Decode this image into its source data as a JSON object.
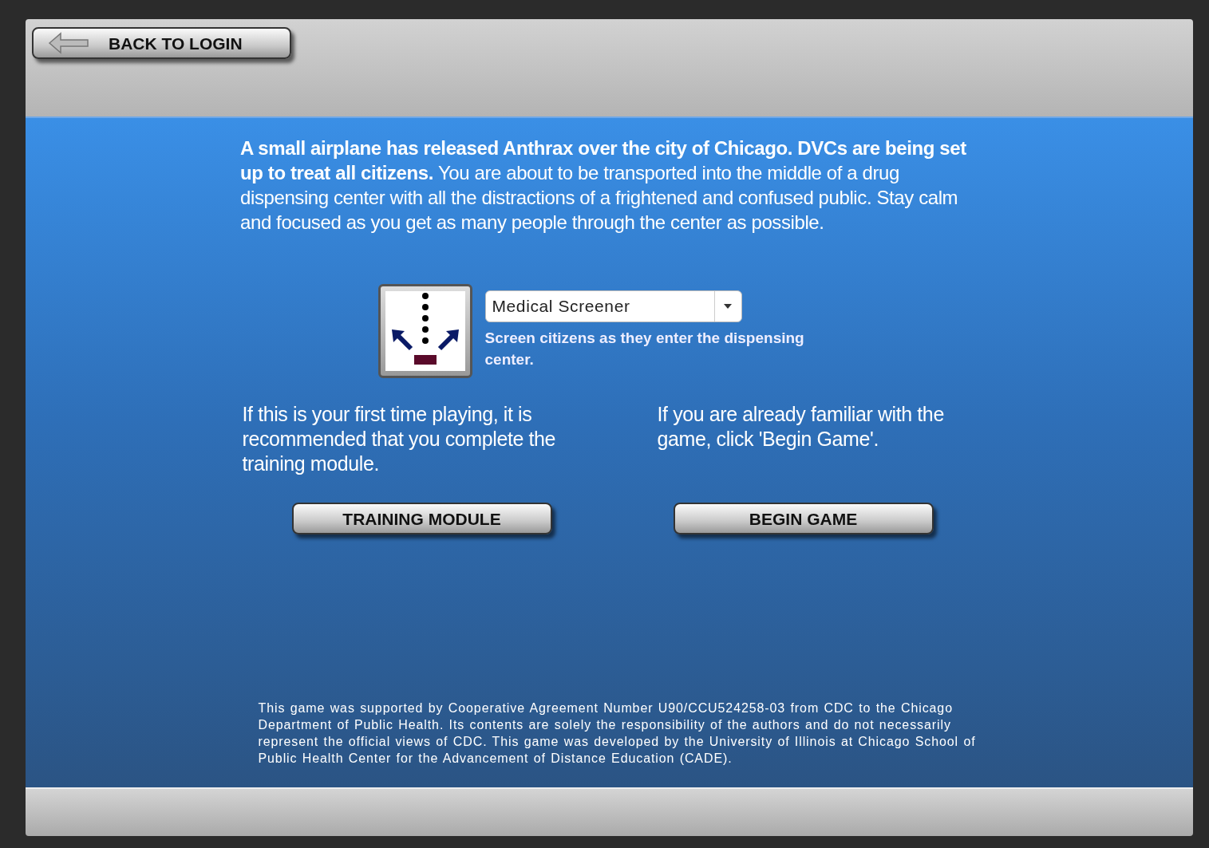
{
  "header": {
    "back_button": {
      "label": "BACK TO LOGIN"
    }
  },
  "intro": "**A small airplane has released Anthrax over the city of Chicago. DVCs are being set up to treat all citizens.** You are about to be transported into the middle of a drug dispensing center with all the distractions of a frightened and confused public. Stay calm and focused as you get as many people through the center as possible.",
  "role": {
    "value": "Medical Screener",
    "description": "Screen citizens as they enter the dispensing center."
  },
  "options": [
    {
      "text": "If this is your first time playing, it is recommended that you complete the training module.",
      "button": "TRAINING MODULE"
    },
    {
      "text": "If you are already familiar with the game, click 'Begin Game'.",
      "button": "BEGIN GAME"
    }
  ],
  "footer_note": "This game was supported by Cooperative Agreement Number U90/CCU524258-03 from CDC to the Chicago Department of Public Health. Its contents are solely the responsibility of the authors and do not necessarily represent the official views of CDC. This game was developed by the University of Illinois at Chicago School of Public Health Center for the Advancement of Distance Education (CADE)."
}
